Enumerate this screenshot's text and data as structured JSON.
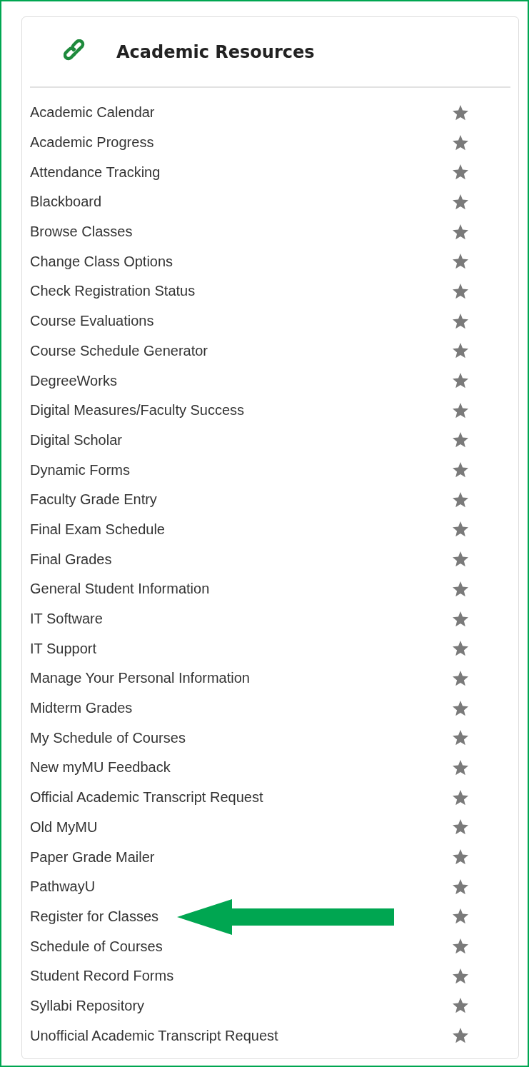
{
  "panel": {
    "title": "Academic Resources"
  },
  "items": [
    {
      "label": "Academic Calendar",
      "favorite": false,
      "arrow": false
    },
    {
      "label": "Academic Progress",
      "favorite": false,
      "arrow": false
    },
    {
      "label": "Attendance Tracking",
      "favorite": false,
      "arrow": false
    },
    {
      "label": "Blackboard",
      "favorite": false,
      "arrow": false
    },
    {
      "label": "Browse Classes",
      "favorite": false,
      "arrow": false
    },
    {
      "label": "Change Class Options",
      "favorite": false,
      "arrow": false
    },
    {
      "label": "Check Registration Status",
      "favorite": false,
      "arrow": false
    },
    {
      "label": "Course Evaluations",
      "favorite": false,
      "arrow": false
    },
    {
      "label": "Course Schedule Generator",
      "favorite": false,
      "arrow": false
    },
    {
      "label": "DegreeWorks",
      "favorite": false,
      "arrow": false
    },
    {
      "label": "Digital Measures/Faculty Success",
      "favorite": false,
      "arrow": false
    },
    {
      "label": "Digital Scholar",
      "favorite": false,
      "arrow": false
    },
    {
      "label": "Dynamic Forms",
      "favorite": false,
      "arrow": false
    },
    {
      "label": "Faculty Grade Entry",
      "favorite": false,
      "arrow": false
    },
    {
      "label": "Final Exam Schedule",
      "favorite": false,
      "arrow": false
    },
    {
      "label": "Final Grades",
      "favorite": false,
      "arrow": false
    },
    {
      "label": "General Student Information",
      "favorite": false,
      "arrow": false
    },
    {
      "label": "IT Software",
      "favorite": false,
      "arrow": false
    },
    {
      "label": "IT Support",
      "favorite": false,
      "arrow": false
    },
    {
      "label": "Manage Your Personal Information",
      "favorite": false,
      "arrow": false
    },
    {
      "label": "Midterm Grades",
      "favorite": false,
      "arrow": false
    },
    {
      "label": "My Schedule of Courses",
      "favorite": false,
      "arrow": false
    },
    {
      "label": "New myMU Feedback",
      "favorite": false,
      "arrow": false
    },
    {
      "label": "Official Academic Transcript Request",
      "favorite": false,
      "arrow": false
    },
    {
      "label": "Old MyMU",
      "favorite": false,
      "arrow": false
    },
    {
      "label": "Paper Grade Mailer",
      "favorite": false,
      "arrow": false
    },
    {
      "label": "PathwayU",
      "favorite": false,
      "arrow": false
    },
    {
      "label": "Register for Classes",
      "favorite": false,
      "arrow": true
    },
    {
      "label": "Schedule of Courses",
      "favorite": false,
      "arrow": false
    },
    {
      "label": "Student Record Forms",
      "favorite": false,
      "arrow": false
    },
    {
      "label": "Syllabi Repository",
      "favorite": false,
      "arrow": false
    },
    {
      "label": "Unofficial Academic Transcript Request",
      "favorite": false,
      "arrow": false
    }
  ]
}
